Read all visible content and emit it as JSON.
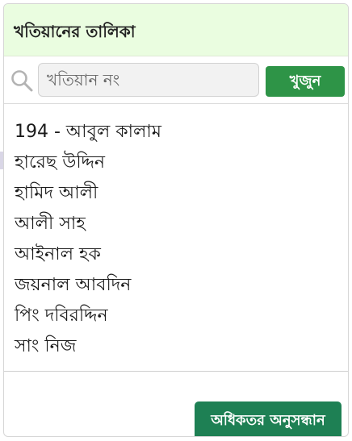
{
  "header": {
    "title": "খতিয়ানের তালিকা"
  },
  "search": {
    "icon": "search-icon",
    "placeholder": "খতিয়ান নং",
    "value": "",
    "button_label": "খুজুন",
    "button_color": "#2e9447"
  },
  "list": {
    "items": [
      {
        "label": "194 - আবুল কালাম"
      },
      {
        "label": "হারেছ উদ্দিন"
      },
      {
        "label": "হামিদ আলী"
      },
      {
        "label": "আলী সাহ"
      },
      {
        "label": "আইনাল হক"
      },
      {
        "label": "জয়নাল আবদিন"
      },
      {
        "label": "পিং দবিরদ্দিন"
      },
      {
        "label": "সাং নিজ"
      }
    ]
  },
  "footer": {
    "more_button_label": "অধিকতর অনুসন্ধান",
    "more_button_color": "#1e8054"
  },
  "colors": {
    "header_background": "#eafde0",
    "border": "#d6d6d6"
  }
}
